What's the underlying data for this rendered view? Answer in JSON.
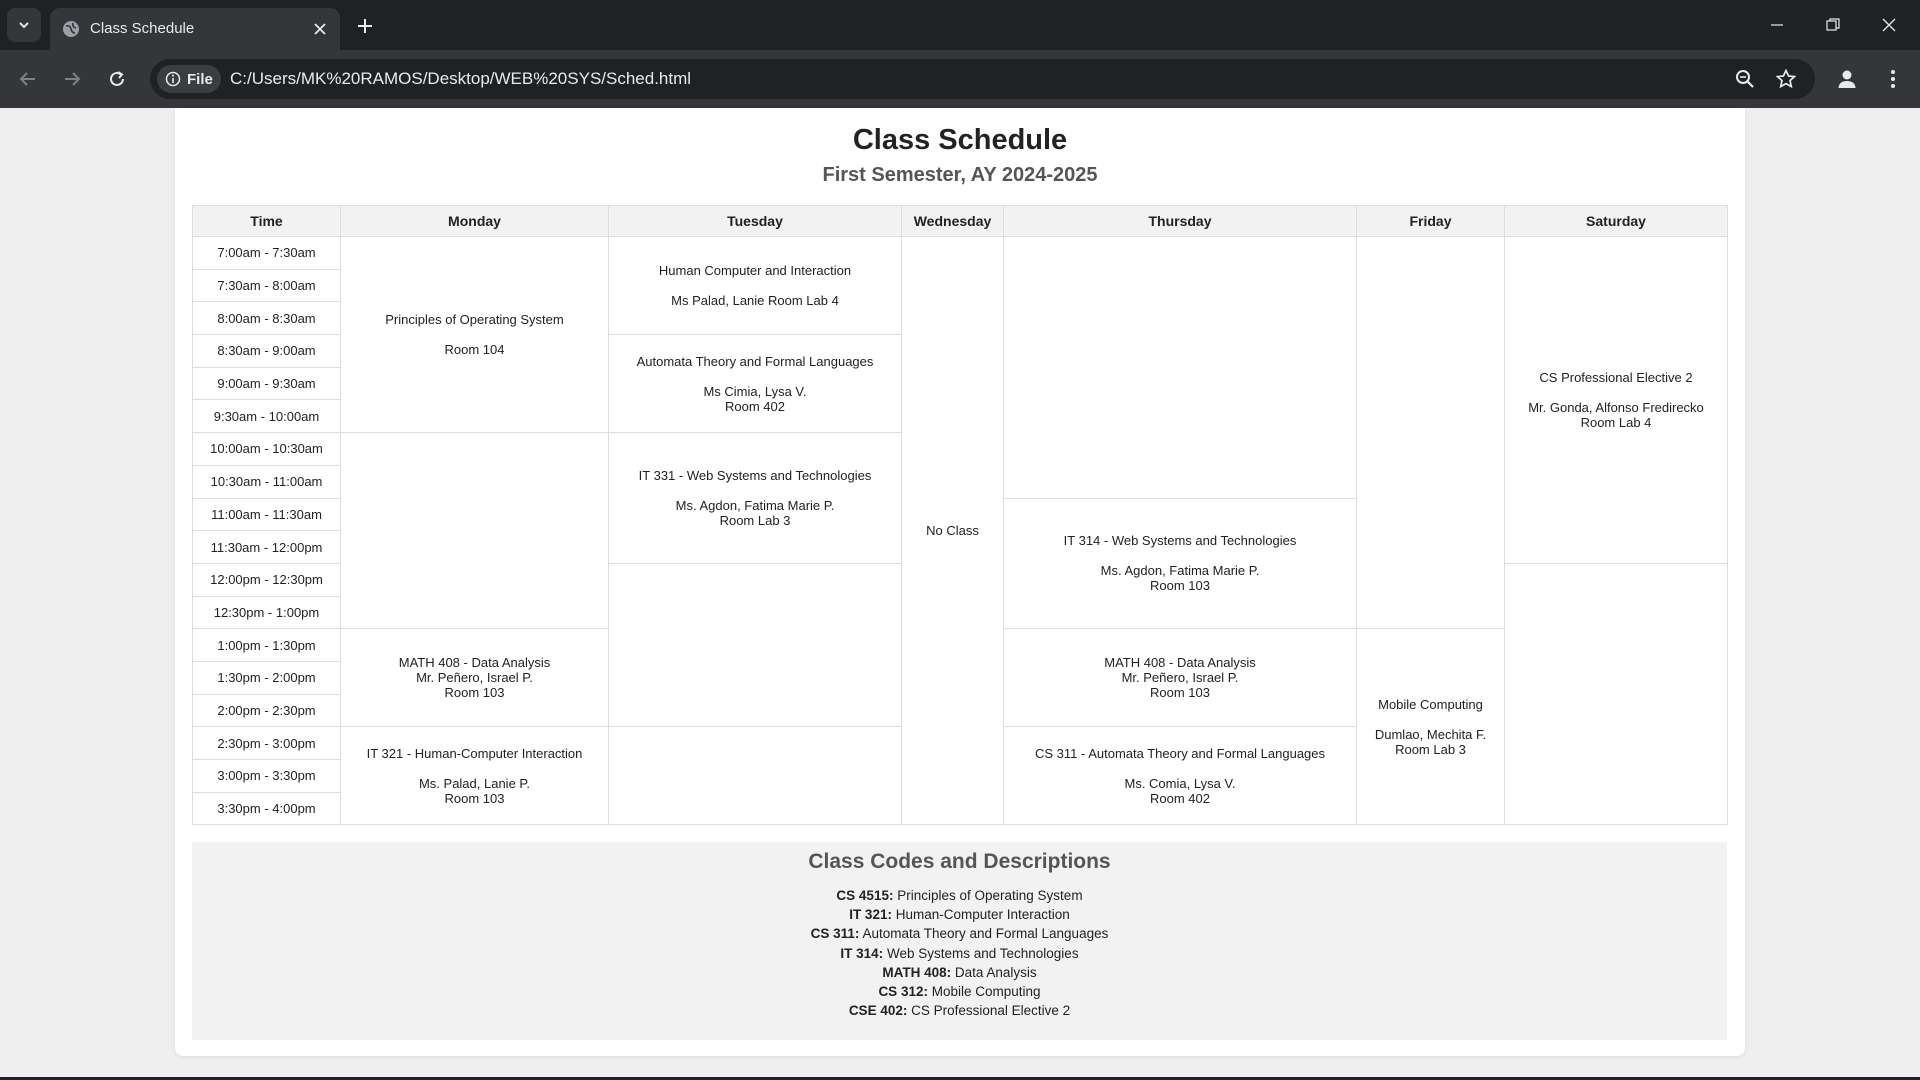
{
  "browser": {
    "tab_title": "Class Schedule",
    "site_chip": "File",
    "url": "C:/Users/MK%20RAMOS/Desktop/WEB%20SYS/Sched.html",
    "icons": [
      "tab-list-icon",
      "globe-icon",
      "close-icon",
      "plus-icon",
      "minimize-icon",
      "restore-icon",
      "close-window-icon",
      "back-arrow-icon",
      "forward-arrow-icon",
      "reload-icon",
      "info-icon",
      "zoom-icon",
      "star-icon",
      "profile-icon",
      "menu-icon"
    ]
  },
  "page": {
    "title": "Class Schedule",
    "subtitle": "First Semester, AY 2024-2025"
  },
  "schedule": {
    "headers": [
      "Time",
      "Monday",
      "Tuesday",
      "Wednesday",
      "Thursday",
      "Friday",
      "Saturday"
    ],
    "times": [
      "7:00am - 7:30am",
      "7:30am - 8:00am",
      "8:00am - 8:30am",
      "8:30am - 9:00am",
      "9:00am - 9:30am",
      "9:30am - 10:00am",
      "10:00am - 10:30am",
      "10:30am - 11:00am",
      "11:00am - 11:30am",
      "11:30am - 12:00pm",
      "12:00pm - 12:30pm",
      "12:30pm - 1:00pm",
      "1:00pm - 1:30pm",
      "1:30pm - 2:00pm",
      "2:00pm - 2:30pm",
      "2:30pm - 3:00pm",
      "3:00pm - 3:30pm",
      "3:30pm - 4:00pm"
    ],
    "classes": {
      "mon_pos": {
        "title": "Principles of Operating System",
        "line1": "Room 104"
      },
      "mon_math": {
        "title": "MATH 408 - Data Analysis",
        "line1": "Mr. Peñero, Israel P.",
        "line2": "Room 103"
      },
      "mon_it321": {
        "title": "IT 321 - Human-Computer Interaction",
        "line1": "Ms. Palad, Lanie P.",
        "line2": "Room 103"
      },
      "tue_hci": {
        "title": "Human Computer and Interaction",
        "line1": "Ms Palad, Lanie Room Lab 4"
      },
      "tue_atfl": {
        "title": "Automata Theory and Formal Languages",
        "line1": "Ms Cimia, Lysa V.",
        "line2": "Room 402"
      },
      "tue_it331": {
        "title": "IT 331 - Web Systems and Technologies",
        "line1": "Ms. Agdon, Fatima Marie P.",
        "line2": "Room Lab 3"
      },
      "wed_none": {
        "title": "No Class"
      },
      "thu_it314": {
        "title": "IT 314 - Web Systems and Technologies",
        "line1": "Ms. Agdon, Fatima Marie P.",
        "line2": "Room 103"
      },
      "thu_math": {
        "title": "MATH 408 - Data Analysis",
        "line1": "Mr. Peñero, Israel P.",
        "line2": "Room 103"
      },
      "thu_cs311": {
        "title": "CS 311 - Automata Theory and Formal Languages",
        "line1": "Ms. Comia, Lysa V.",
        "line2": "Room 402"
      },
      "fri_mobile": {
        "title": "Mobile Computing",
        "line1": "Dumlao, Mechita F.",
        "line2": "Room Lab 3"
      },
      "sat_elective": {
        "title": "CS Professional Elective 2",
        "line1": "Mr. Gonda, Alfonso Fredirecko",
        "line2": "Room Lab 4"
      }
    }
  },
  "codes": {
    "heading": "Class Codes and Descriptions",
    "items": [
      {
        "code": "CS 4515:",
        "desc": "Principles of Operating System"
      },
      {
        "code": "IT 321:",
        "desc": "Human-Computer Interaction"
      },
      {
        "code": "CS 311:",
        "desc": "Automata Theory and Formal Languages"
      },
      {
        "code": "IT 314:",
        "desc": "Web Systems and Technologies"
      },
      {
        "code": "MATH 408:",
        "desc": "Data Analysis"
      },
      {
        "code": "CS 312:",
        "desc": "Mobile Computing"
      },
      {
        "code": "CSE 402:",
        "desc": "CS Professional Elective 2"
      }
    ]
  }
}
